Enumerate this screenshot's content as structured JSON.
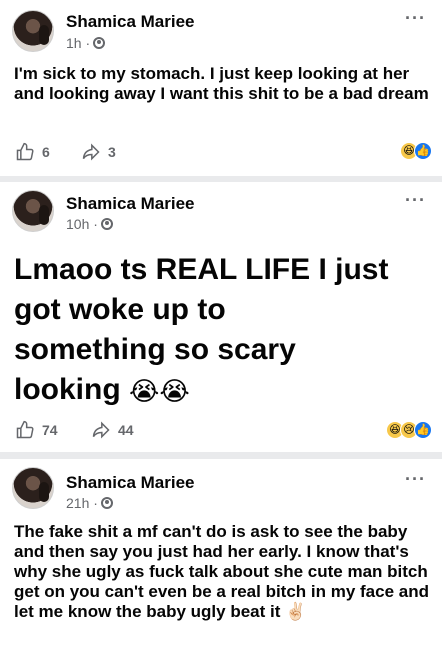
{
  "posts": [
    {
      "author": "Shamica Mariee",
      "time": "1h · ",
      "text": "I'm sick to my stomach. I just keep looking at her and looking away I want this shit to be a bad dream",
      "likes": "6",
      "shares": "3",
      "reactions": [
        "haha",
        "like"
      ]
    },
    {
      "author": "Shamica Mariee",
      "time": "10h · ",
      "text_lines": [
        "Lmaoo ts REAL LIFE I just",
        "got woke up to",
        "something so scary",
        "looking"
      ],
      "emoji": "😭😭",
      "likes": "74",
      "shares": "44",
      "reactions": [
        "haha",
        "sad",
        "like"
      ]
    },
    {
      "author": "Shamica Mariee",
      "time": "21h · ",
      "text": "The fake shit a mf can't do is ask to see the baby and then say you just had her early. I know that's why she ugly as fuck talk about she cute man bitch get on you can't even be a real bitch in my face and let me know the baby ugly beat it",
      "emoji": "✌🏻"
    }
  ],
  "icons": {
    "more": "more-options-icon",
    "globe": "public-globe-icon",
    "like": "like-thumb-icon",
    "share": "share-arrow-icon"
  },
  "colors": {
    "accent": "#1877f2",
    "muted": "#65676b",
    "text": "#050505"
  }
}
